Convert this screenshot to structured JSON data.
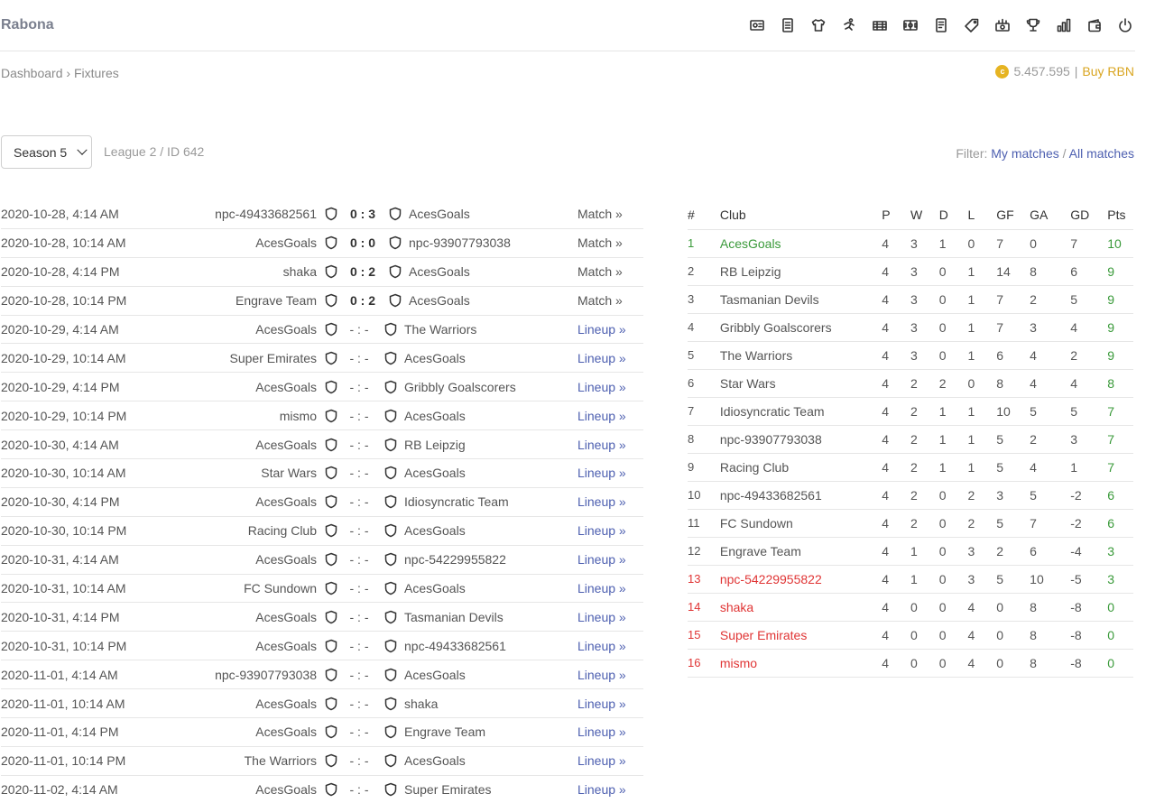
{
  "header": {
    "brand": "Rabona",
    "icons": [
      "scout-icon",
      "squad-icon",
      "shirt-icon",
      "training-icon",
      "stadium-icon",
      "field-icon",
      "news-icon",
      "tag-icon",
      "chart-money-icon",
      "trophy-icon",
      "stats-icon",
      "wallet-icon",
      "power-icon"
    ]
  },
  "breadcrumb": {
    "home": "Dashboard",
    "separator": "›",
    "current": "Fixtures"
  },
  "balance": {
    "coin_symbol": "c",
    "amount": "5.457.595",
    "separator": "|",
    "buy_label": "Buy RBN"
  },
  "season": {
    "selected": "Season 5"
  },
  "league_info": "League 2 / ID 642",
  "filter": {
    "label": "Filter:",
    "my_matches": "My matches",
    "separator": "/",
    "all_matches": "All matches"
  },
  "fixtures": [
    {
      "date": "2020-10-28, 4:14 AM",
      "home": "npc-49433682561",
      "score": "0 : 3",
      "away": "AcesGoals",
      "link": "Match »",
      "played": true
    },
    {
      "date": "2020-10-28, 10:14 AM",
      "home": "AcesGoals",
      "score": "0 : 0",
      "away": "npc-93907793038",
      "link": "Match »",
      "played": true
    },
    {
      "date": "2020-10-28, 4:14 PM",
      "home": "shaka",
      "score": "0 : 2",
      "away": "AcesGoals",
      "link": "Match »",
      "played": true
    },
    {
      "date": "2020-10-28, 10:14 PM",
      "home": "Engrave Team",
      "score": "0 : 2",
      "away": "AcesGoals",
      "link": "Match »",
      "played": true
    },
    {
      "date": "2020-10-29, 4:14 AM",
      "home": "AcesGoals",
      "score": "- : -",
      "away": "The Warriors",
      "link": "Lineup »",
      "played": false
    },
    {
      "date": "2020-10-29, 10:14 AM",
      "home": "Super Emirates",
      "score": "- : -",
      "away": "AcesGoals",
      "link": "Lineup »",
      "played": false
    },
    {
      "date": "2020-10-29, 4:14 PM",
      "home": "AcesGoals",
      "score": "- : -",
      "away": "Gribbly Goalscorers",
      "link": "Lineup »",
      "played": false
    },
    {
      "date": "2020-10-29, 10:14 PM",
      "home": "mismo",
      "score": "- : -",
      "away": "AcesGoals",
      "link": "Lineup »",
      "played": false
    },
    {
      "date": "2020-10-30, 4:14 AM",
      "home": "AcesGoals",
      "score": "- : -",
      "away": "RB Leipzig",
      "link": "Lineup »",
      "played": false
    },
    {
      "date": "2020-10-30, 10:14 AM",
      "home": "Star Wars",
      "score": "- : -",
      "away": "AcesGoals",
      "link": "Lineup »",
      "played": false
    },
    {
      "date": "2020-10-30, 4:14 PM",
      "home": "AcesGoals",
      "score": "- : -",
      "away": "Idiosyncratic Team",
      "link": "Lineup »",
      "played": false
    },
    {
      "date": "2020-10-30, 10:14 PM",
      "home": "Racing Club",
      "score": "- : -",
      "away": "AcesGoals",
      "link": "Lineup »",
      "played": false
    },
    {
      "date": "2020-10-31, 4:14 AM",
      "home": "AcesGoals",
      "score": "- : -",
      "away": "npc-54229955822",
      "link": "Lineup »",
      "played": false
    },
    {
      "date": "2020-10-31, 10:14 AM",
      "home": "FC Sundown",
      "score": "- : -",
      "away": "AcesGoals",
      "link": "Lineup »",
      "played": false
    },
    {
      "date": "2020-10-31, 4:14 PM",
      "home": "AcesGoals",
      "score": "- : -",
      "away": "Tasmanian Devils",
      "link": "Lineup »",
      "played": false
    },
    {
      "date": "2020-10-31, 10:14 PM",
      "home": "AcesGoals",
      "score": "- : -",
      "away": "npc-49433682561",
      "link": "Lineup »",
      "played": false
    },
    {
      "date": "2020-11-01, 4:14 AM",
      "home": "npc-93907793038",
      "score": "- : -",
      "away": "AcesGoals",
      "link": "Lineup »",
      "played": false
    },
    {
      "date": "2020-11-01, 10:14 AM",
      "home": "AcesGoals",
      "score": "- : -",
      "away": "shaka",
      "link": "Lineup »",
      "played": false
    },
    {
      "date": "2020-11-01, 4:14 PM",
      "home": "AcesGoals",
      "score": "- : -",
      "away": "Engrave Team",
      "link": "Lineup »",
      "played": false
    },
    {
      "date": "2020-11-01, 10:14 PM",
      "home": "The Warriors",
      "score": "- : -",
      "away": "AcesGoals",
      "link": "Lineup »",
      "played": false
    },
    {
      "date": "2020-11-02, 4:14 AM",
      "home": "AcesGoals",
      "score": "- : -",
      "away": "Super Emirates",
      "link": "Lineup »",
      "played": false
    }
  ],
  "standings": {
    "headers": [
      "#",
      "Club",
      "P",
      "W",
      "D",
      "L",
      "GF",
      "GA",
      "GD",
      "Pts"
    ],
    "rows": [
      {
        "rank": "1",
        "club": "AcesGoals",
        "p": "4",
        "w": "3",
        "d": "1",
        "l": "0",
        "gf": "7",
        "ga": "0",
        "gd": "7",
        "pts": "10",
        "zone": "green"
      },
      {
        "rank": "2",
        "club": "RB Leipzig",
        "p": "4",
        "w": "3",
        "d": "0",
        "l": "1",
        "gf": "14",
        "ga": "8",
        "gd": "6",
        "pts": "9",
        "zone": ""
      },
      {
        "rank": "3",
        "club": "Tasmanian Devils",
        "p": "4",
        "w": "3",
        "d": "0",
        "l": "1",
        "gf": "7",
        "ga": "2",
        "gd": "5",
        "pts": "9",
        "zone": ""
      },
      {
        "rank": "4",
        "club": "Gribbly Goalscorers",
        "p": "4",
        "w": "3",
        "d": "0",
        "l": "1",
        "gf": "7",
        "ga": "3",
        "gd": "4",
        "pts": "9",
        "zone": ""
      },
      {
        "rank": "5",
        "club": "The Warriors",
        "p": "4",
        "w": "3",
        "d": "0",
        "l": "1",
        "gf": "6",
        "ga": "4",
        "gd": "2",
        "pts": "9",
        "zone": ""
      },
      {
        "rank": "6",
        "club": "Star Wars",
        "p": "4",
        "w": "2",
        "d": "2",
        "l": "0",
        "gf": "8",
        "ga": "4",
        "gd": "4",
        "pts": "8",
        "zone": ""
      },
      {
        "rank": "7",
        "club": "Idiosyncratic Team",
        "p": "4",
        "w": "2",
        "d": "1",
        "l": "1",
        "gf": "10",
        "ga": "5",
        "gd": "5",
        "pts": "7",
        "zone": ""
      },
      {
        "rank": "8",
        "club": "npc-93907793038",
        "p": "4",
        "w": "2",
        "d": "1",
        "l": "1",
        "gf": "5",
        "ga": "2",
        "gd": "3",
        "pts": "7",
        "zone": ""
      },
      {
        "rank": "9",
        "club": "Racing Club",
        "p": "4",
        "w": "2",
        "d": "1",
        "l": "1",
        "gf": "5",
        "ga": "4",
        "gd": "1",
        "pts": "7",
        "zone": ""
      },
      {
        "rank": "10",
        "club": "npc-49433682561",
        "p": "4",
        "w": "2",
        "d": "0",
        "l": "2",
        "gf": "3",
        "ga": "5",
        "gd": "-2",
        "pts": "6",
        "zone": ""
      },
      {
        "rank": "11",
        "club": "FC Sundown",
        "p": "4",
        "w": "2",
        "d": "0",
        "l": "2",
        "gf": "5",
        "ga": "7",
        "gd": "-2",
        "pts": "6",
        "zone": ""
      },
      {
        "rank": "12",
        "club": "Engrave Team",
        "p": "4",
        "w": "1",
        "d": "0",
        "l": "3",
        "gf": "2",
        "ga": "6",
        "gd": "-4",
        "pts": "3",
        "zone": ""
      },
      {
        "rank": "13",
        "club": "npc-54229955822",
        "p": "4",
        "w": "1",
        "d": "0",
        "l": "3",
        "gf": "5",
        "ga": "10",
        "gd": "-5",
        "pts": "3",
        "zone": "red"
      },
      {
        "rank": "14",
        "club": "shaka",
        "p": "4",
        "w": "0",
        "d": "0",
        "l": "4",
        "gf": "0",
        "ga": "8",
        "gd": "-8",
        "pts": "0",
        "zone": "red"
      },
      {
        "rank": "15",
        "club": "Super Emirates",
        "p": "4",
        "w": "0",
        "d": "0",
        "l": "4",
        "gf": "0",
        "ga": "8",
        "gd": "-8",
        "pts": "0",
        "zone": "red"
      },
      {
        "rank": "16",
        "club": "mismo",
        "p": "4",
        "w": "0",
        "d": "0",
        "l": "4",
        "gf": "0",
        "ga": "8",
        "gd": "-8",
        "pts": "0",
        "zone": "red"
      }
    ]
  },
  "colors": {
    "link": "#4d5fb0",
    "promotion": "#3a9a3a",
    "relegation": "#e03535",
    "coin": "#e6b422"
  }
}
